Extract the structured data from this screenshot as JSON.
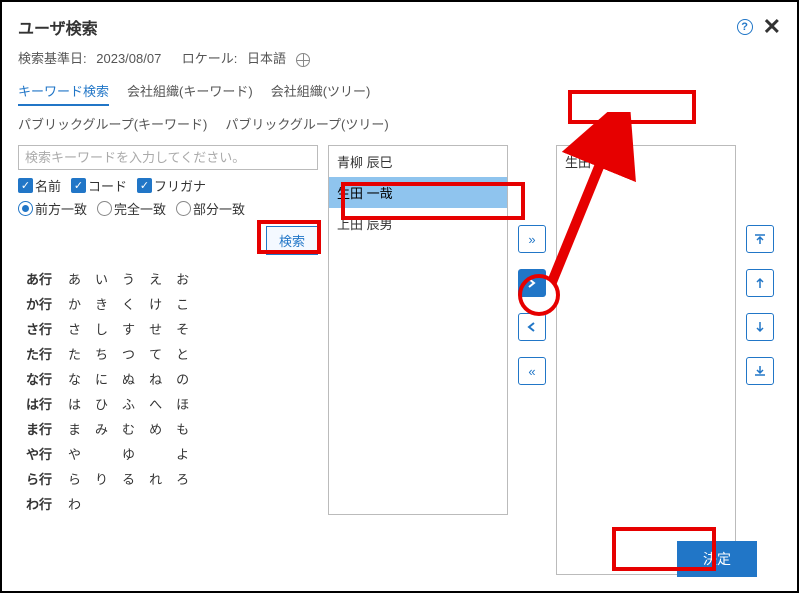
{
  "title": "ユーザ検索",
  "infoRow": {
    "baseDateLabel": "検索基準日:",
    "baseDateValue": "2023/08/07",
    "localeLabel": "ロケール:",
    "localeValue": "日本語"
  },
  "tabs": {
    "row1": [
      {
        "label": "キーワード検索",
        "active": true
      },
      {
        "label": "会社組織(キーワード)",
        "active": false
      },
      {
        "label": "会社組織(ツリー)",
        "active": false
      }
    ],
    "row2": [
      {
        "label": "パブリックグループ(キーワード)",
        "active": false
      },
      {
        "label": "パブリックグループ(ツリー)",
        "active": false
      }
    ]
  },
  "searchPlaceholder": "検索キーワードを入力してください。",
  "checkboxes": [
    {
      "label": "名前",
      "checked": true
    },
    {
      "label": "コード",
      "checked": true
    },
    {
      "label": "フリガナ",
      "checked": true
    }
  ],
  "radios": [
    {
      "label": "前方一致",
      "selected": true
    },
    {
      "label": "完全一致",
      "selected": false
    },
    {
      "label": "部分一致",
      "selected": false
    }
  ],
  "searchButton": "検索",
  "kanaRows": [
    {
      "label": "あ行",
      "items": [
        "あ",
        "い",
        "う",
        "え",
        "お"
      ]
    },
    {
      "label": "か行",
      "items": [
        "か",
        "き",
        "く",
        "け",
        "こ"
      ]
    },
    {
      "label": "さ行",
      "items": [
        "さ",
        "し",
        "す",
        "せ",
        "そ"
      ]
    },
    {
      "label": "た行",
      "items": [
        "た",
        "ち",
        "つ",
        "て",
        "と"
      ]
    },
    {
      "label": "な行",
      "items": [
        "な",
        "に",
        "ぬ",
        "ね",
        "の"
      ]
    },
    {
      "label": "は行",
      "items": [
        "は",
        "ひ",
        "ふ",
        "へ",
        "ほ"
      ]
    },
    {
      "label": "ま行",
      "items": [
        "ま",
        "み",
        "む",
        "め",
        "も"
      ]
    },
    {
      "label": "や行",
      "items": [
        "や",
        "",
        "ゆ",
        "",
        "よ"
      ]
    },
    {
      "label": "ら行",
      "items": [
        "ら",
        "り",
        "る",
        "れ",
        "ろ"
      ]
    },
    {
      "label": "わ行",
      "items": [
        "わ",
        "",
        "",
        "",
        ""
      ]
    }
  ],
  "resultList": [
    {
      "label": "青柳 辰巳",
      "selected": false
    },
    {
      "label": "生田 一哉",
      "selected": true
    },
    {
      "label": "上田 辰男",
      "selected": false
    }
  ],
  "selectedList": [
    {
      "label": "生田 一哉"
    }
  ],
  "transferButtons": {
    "allRight": "»",
    "right": "›",
    "left": "‹",
    "allLeft": "«"
  },
  "orderButtons": {
    "top": "⤒",
    "up": "↑",
    "down": "↓",
    "bottom": "⤓"
  },
  "decideButton": "決定"
}
